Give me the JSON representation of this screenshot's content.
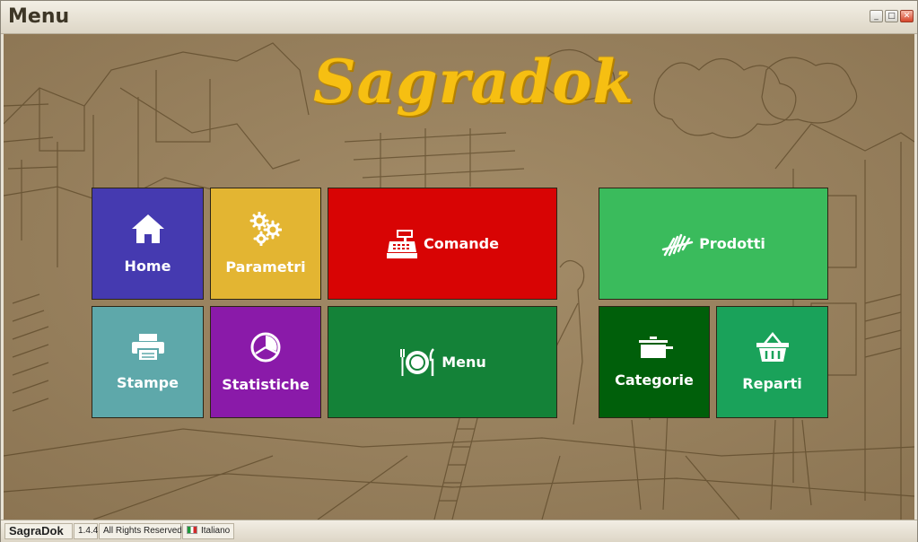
{
  "window": {
    "title": "Menu",
    "minimize_glyph": "_",
    "maximize_glyph": "□",
    "close_glyph": "✕"
  },
  "logo": "Sagradok",
  "tiles": {
    "home": {
      "label": "Home",
      "icon": "home-icon",
      "color": "#453ab0"
    },
    "parametri": {
      "label": "Parametri",
      "icon": "gears-icon",
      "color": "#e3b532"
    },
    "comande": {
      "label": "Comande",
      "icon": "cash-register-icon",
      "color": "#d80404"
    },
    "prodotti": {
      "label": "Prodotti",
      "icon": "fries-icon",
      "color": "#3abb5c"
    },
    "stampe": {
      "label": "Stampe",
      "icon": "printer-icon",
      "color": "#5ea8aa"
    },
    "statistiche": {
      "label": "Statistiche",
      "icon": "pie-chart-icon",
      "color": "#8a1aa9"
    },
    "menu": {
      "label": "Menu",
      "icon": "plate-cutlery-icon",
      "color": "#148238"
    },
    "categorie": {
      "label": "Categorie",
      "icon": "pot-icon",
      "color": "#005f0a"
    },
    "reparti": {
      "label": "Reparti",
      "icon": "basket-icon",
      "color": "#1aa25a"
    }
  },
  "statusbar": {
    "app_name": "SagraDok",
    "version": "1.4.4",
    "rights": "All Rights Reserved",
    "language": "Italiano"
  }
}
